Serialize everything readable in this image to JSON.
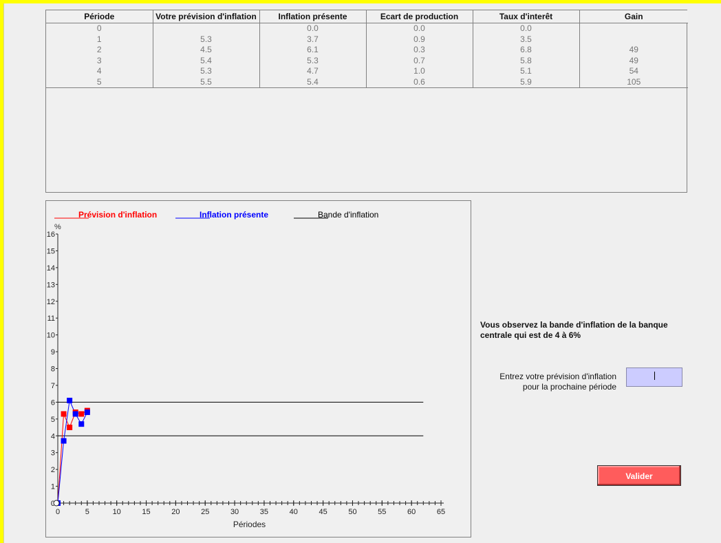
{
  "table": {
    "headers": [
      "Période",
      "Votre prévision d'inflation",
      "Inflation présente",
      "Ecart de production",
      "Taux d'interêt",
      "Gain"
    ],
    "rows": [
      [
        "0",
        "",
        "0.0",
        "0.0",
        "0.0",
        ""
      ],
      [
        "1",
        "5.3",
        "3.7",
        "0.9",
        "3.5",
        ""
      ],
      [
        "2",
        "4.5",
        "6.1",
        "0.3",
        "6.8",
        "49"
      ],
      [
        "3",
        "5.4",
        "5.3",
        "0.7",
        "5.8",
        "49"
      ],
      [
        "4",
        "5.3",
        "4.7",
        "1.0",
        "5.1",
        "54"
      ],
      [
        "5",
        "5.5",
        "5.4",
        "0.6",
        "5.9",
        "105"
      ]
    ]
  },
  "chart_data": {
    "type": "line",
    "legend": [
      {
        "label": "Prévision d'inflation",
        "color": "#ff0000"
      },
      {
        "label": "Inflation présente",
        "color": "#0000ff"
      },
      {
        "label": "Bande d'inflation",
        "color": "#000000"
      }
    ],
    "ylabel": "%",
    "xlabel": "Périodes",
    "xlim": [
      0,
      65
    ],
    "ylim": [
      0,
      16
    ],
    "xticks": [
      0,
      5,
      10,
      15,
      20,
      25,
      30,
      35,
      40,
      45,
      50,
      55,
      60,
      65
    ],
    "yticks": [
      0,
      1,
      2,
      3,
      4,
      5,
      6,
      7,
      8,
      9,
      10,
      11,
      12,
      13,
      14,
      15,
      16
    ],
    "series": [
      {
        "name": "Prévision d'inflation",
        "color": "#ff0000",
        "x": [
          0,
          1,
          2,
          3,
          4,
          5
        ],
        "y": [
          0,
          5.3,
          4.5,
          5.4,
          5.3,
          5.5
        ]
      },
      {
        "name": "Inflation présente",
        "color": "#0000ff",
        "x": [
          0,
          1,
          2,
          3,
          4,
          5
        ],
        "y": [
          0,
          3.7,
          6.1,
          5.3,
          4.7,
          5.4
        ]
      }
    ],
    "band": {
      "name": "Bande d'inflation",
      "color": "#000000",
      "lower": 4,
      "upper": 6,
      "x_end": 62
    }
  },
  "panel": {
    "info": "Vous observez la bande d'inflation de la banque centrale qui est de 4 à 6%",
    "input_label_line1": "Entrez votre prévision d'inflation",
    "input_label_line2": "pour la prochaine période",
    "input_value": "",
    "submit_label": "Valider"
  }
}
